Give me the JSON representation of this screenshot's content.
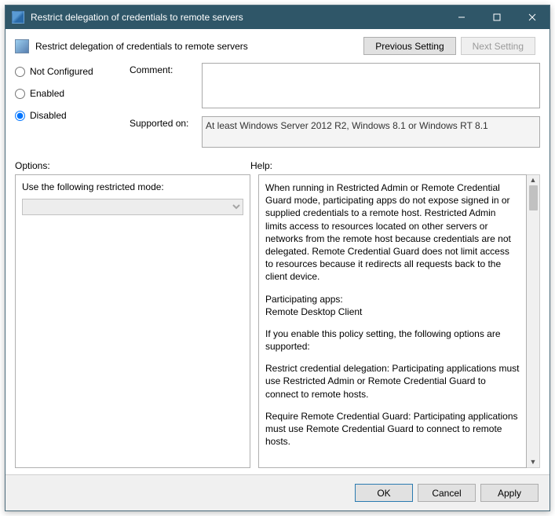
{
  "window": {
    "title": "Restrict delegation of credentials to remote servers"
  },
  "header": {
    "policy_name": "Restrict delegation of credentials to remote servers",
    "prev_btn": "Previous Setting",
    "next_btn": "Next Setting"
  },
  "state": {
    "not_configured": "Not Configured",
    "enabled": "Enabled",
    "disabled": "Disabled",
    "selected": "disabled"
  },
  "comment": {
    "label": "Comment:",
    "value": ""
  },
  "supported": {
    "label": "Supported on:",
    "text": "At least Windows Server 2012 R2, Windows 8.1 or Windows RT 8.1"
  },
  "labels": {
    "options": "Options:",
    "help": "Help:"
  },
  "options": {
    "restricted_mode_label": "Use the following restricted mode:",
    "selected": ""
  },
  "help": {
    "p1": "When running in Restricted Admin or Remote Credential Guard mode, participating apps do not expose signed in or supplied credentials to a remote host. Restricted Admin limits access to resources located on other servers or networks from the remote host because credentials are not delegated. Remote Credential Guard does not limit access to resources because it redirects all requests back to the client device.",
    "p2a": "Participating apps:",
    "p2b": "Remote Desktop Client",
    "p3": "If you enable this policy setting, the following options are supported:",
    "p4": "Restrict credential delegation: Participating applications must use Restricted Admin or Remote Credential Guard to connect to remote hosts.",
    "p5": "Require Remote Credential Guard: Participating applications must use Remote Credential Guard to connect to remote hosts."
  },
  "footer": {
    "ok": "OK",
    "cancel": "Cancel",
    "apply": "Apply"
  }
}
